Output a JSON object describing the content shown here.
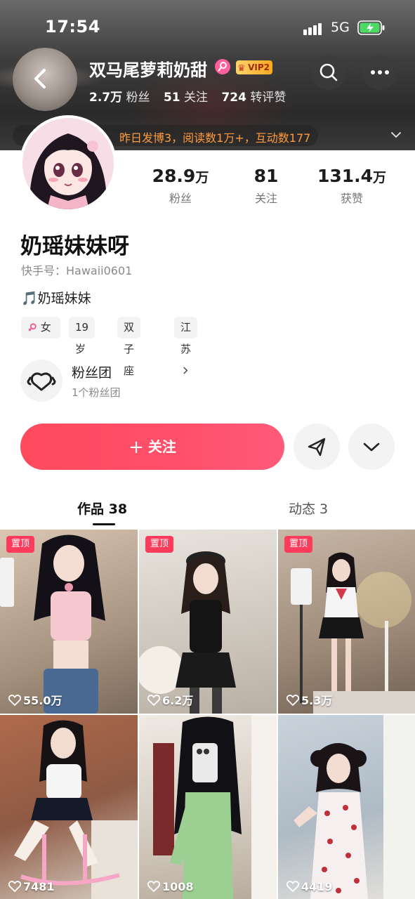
{
  "status_bar": {
    "time": "17:54",
    "network": "5G"
  },
  "header": {
    "name": "双马尾萝莉奶甜",
    "vip": "VIP2",
    "fans_num": "2.7万",
    "fans_label": "粉丝",
    "following_num": "51",
    "following_label": "关注",
    "reposts_num": "724",
    "reposts_label": "转评赞",
    "notice": "昨日发博3，阅读数1万+，互动数177"
  },
  "profile": {
    "stats": [
      {
        "num": "28.9",
        "unit": "万",
        "label": "粉丝"
      },
      {
        "num": "81",
        "unit": "",
        "label": "关注"
      },
      {
        "num": "131.4",
        "unit": "万",
        "label": "获赞"
      }
    ],
    "nickname": "奶瑶妹妹呀",
    "kuaishou_id": "快手号：Hawaii0601",
    "bio": "🎵奶瑶妹妹",
    "tags": {
      "gender": "女",
      "age": "19岁",
      "zodiac": "双子座",
      "region": "江苏"
    },
    "fans_group": {
      "title": "粉丝团",
      "subtitle": "1个粉丝团"
    }
  },
  "actions": {
    "follow_label": "关注"
  },
  "tabs": [
    {
      "label": "作品 38",
      "active": true
    },
    {
      "label": "动态 3",
      "active": false
    }
  ],
  "posts": [
    {
      "pinned": true,
      "pin_label": "置顶",
      "likes": "55.0万"
    },
    {
      "pinned": true,
      "pin_label": "置顶",
      "likes": "6.2万"
    },
    {
      "pinned": true,
      "pin_label": "置顶",
      "likes": "5.3万"
    },
    {
      "pinned": false,
      "likes": "7481"
    },
    {
      "pinned": false,
      "likes": "1008"
    },
    {
      "pinned": false,
      "likes": "4419"
    }
  ],
  "colors": {
    "accent": "#ff4a5e",
    "notice": "#ff9a3d",
    "pin": "#ff3b5c"
  }
}
